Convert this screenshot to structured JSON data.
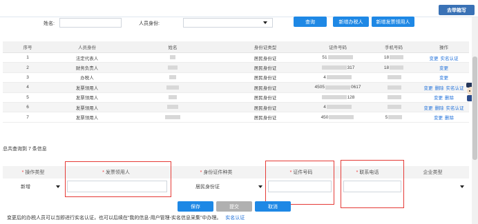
{
  "header": {
    "mailbox_label": "去举箱写"
  },
  "search": {
    "name_label": "姓名:",
    "role_label": "人员身份:",
    "query_button": "查询",
    "add_tax_person_button": "新增办税人",
    "add_invoice_receiver_button": "新增发票领用人"
  },
  "table": {
    "columns": [
      "序号",
      "人员身份",
      "姓名",
      "身份证类型",
      "证件号码",
      "手机号码",
      "操作"
    ],
    "rows": [
      {
        "no": "1",
        "role": "法定代表人",
        "id_type": "居民身份证",
        "id_prefix": "51",
        "id_suffix": "",
        "phone": "18",
        "actions": [
          "变更",
          "实名认证"
        ]
      },
      {
        "no": "2",
        "role": "财务负责人",
        "id_type": "居民身份证",
        "id_prefix": "",
        "id_suffix": "317",
        "phone": "18",
        "actions": [
          "变更"
        ]
      },
      {
        "no": "3",
        "role": "办税人",
        "id_type": "居民身份证",
        "id_prefix": "4",
        "id_suffix": "",
        "phone": "",
        "actions": [
          "变更"
        ]
      },
      {
        "no": "4",
        "role": "发票领用人",
        "id_type": "居民身份证",
        "id_prefix": "4505",
        "id_suffix": "0617",
        "phone": "",
        "actions": [
          "变更",
          "删除",
          "实名认证"
        ]
      },
      {
        "no": "5",
        "role": "发票领用人",
        "id_type": "居民身份证",
        "id_prefix": "",
        "id_suffix": "128",
        "phone": "",
        "actions": [
          "变更",
          "删除"
        ]
      },
      {
        "no": "6",
        "role": "发票领用人",
        "id_type": "居民身份证",
        "id_prefix": "4",
        "id_suffix": "",
        "phone": "",
        "actions": [
          "变更",
          "删除",
          "实名认证"
        ]
      },
      {
        "no": "7",
        "role": "发票领用人",
        "id_type": "居民身份证",
        "id_prefix": "450",
        "id_suffix": "",
        "phone": "5",
        "actions": [
          "变更",
          "删除"
        ]
      }
    ]
  },
  "summary": "总共查询到 7 条信息",
  "form": {
    "columns": [
      {
        "label": "操作类型",
        "required": true
      },
      {
        "label": "发票领用人",
        "required": true
      },
      {
        "label": "身份证件种类",
        "required": true
      },
      {
        "label": "证件号码",
        "required": true
      },
      {
        "label": "联系电话",
        "required": true
      },
      {
        "label": "企业类型",
        "required": false
      }
    ],
    "op_type_value": "新增",
    "id_kind_value": "居民身份证",
    "save_button": "保存",
    "submit_button": "提交",
    "cancel_button": "取消"
  },
  "footer": {
    "note": "变更后的办税人员可以当即进行实名认证，也可以后续在“我的信息-用户管理-实名信息采集”中办理。",
    "link": "实名认证"
  },
  "colors": {
    "accent": "#1e88e5",
    "highlight": "#e53935",
    "header_button": "#3a72b6"
  }
}
